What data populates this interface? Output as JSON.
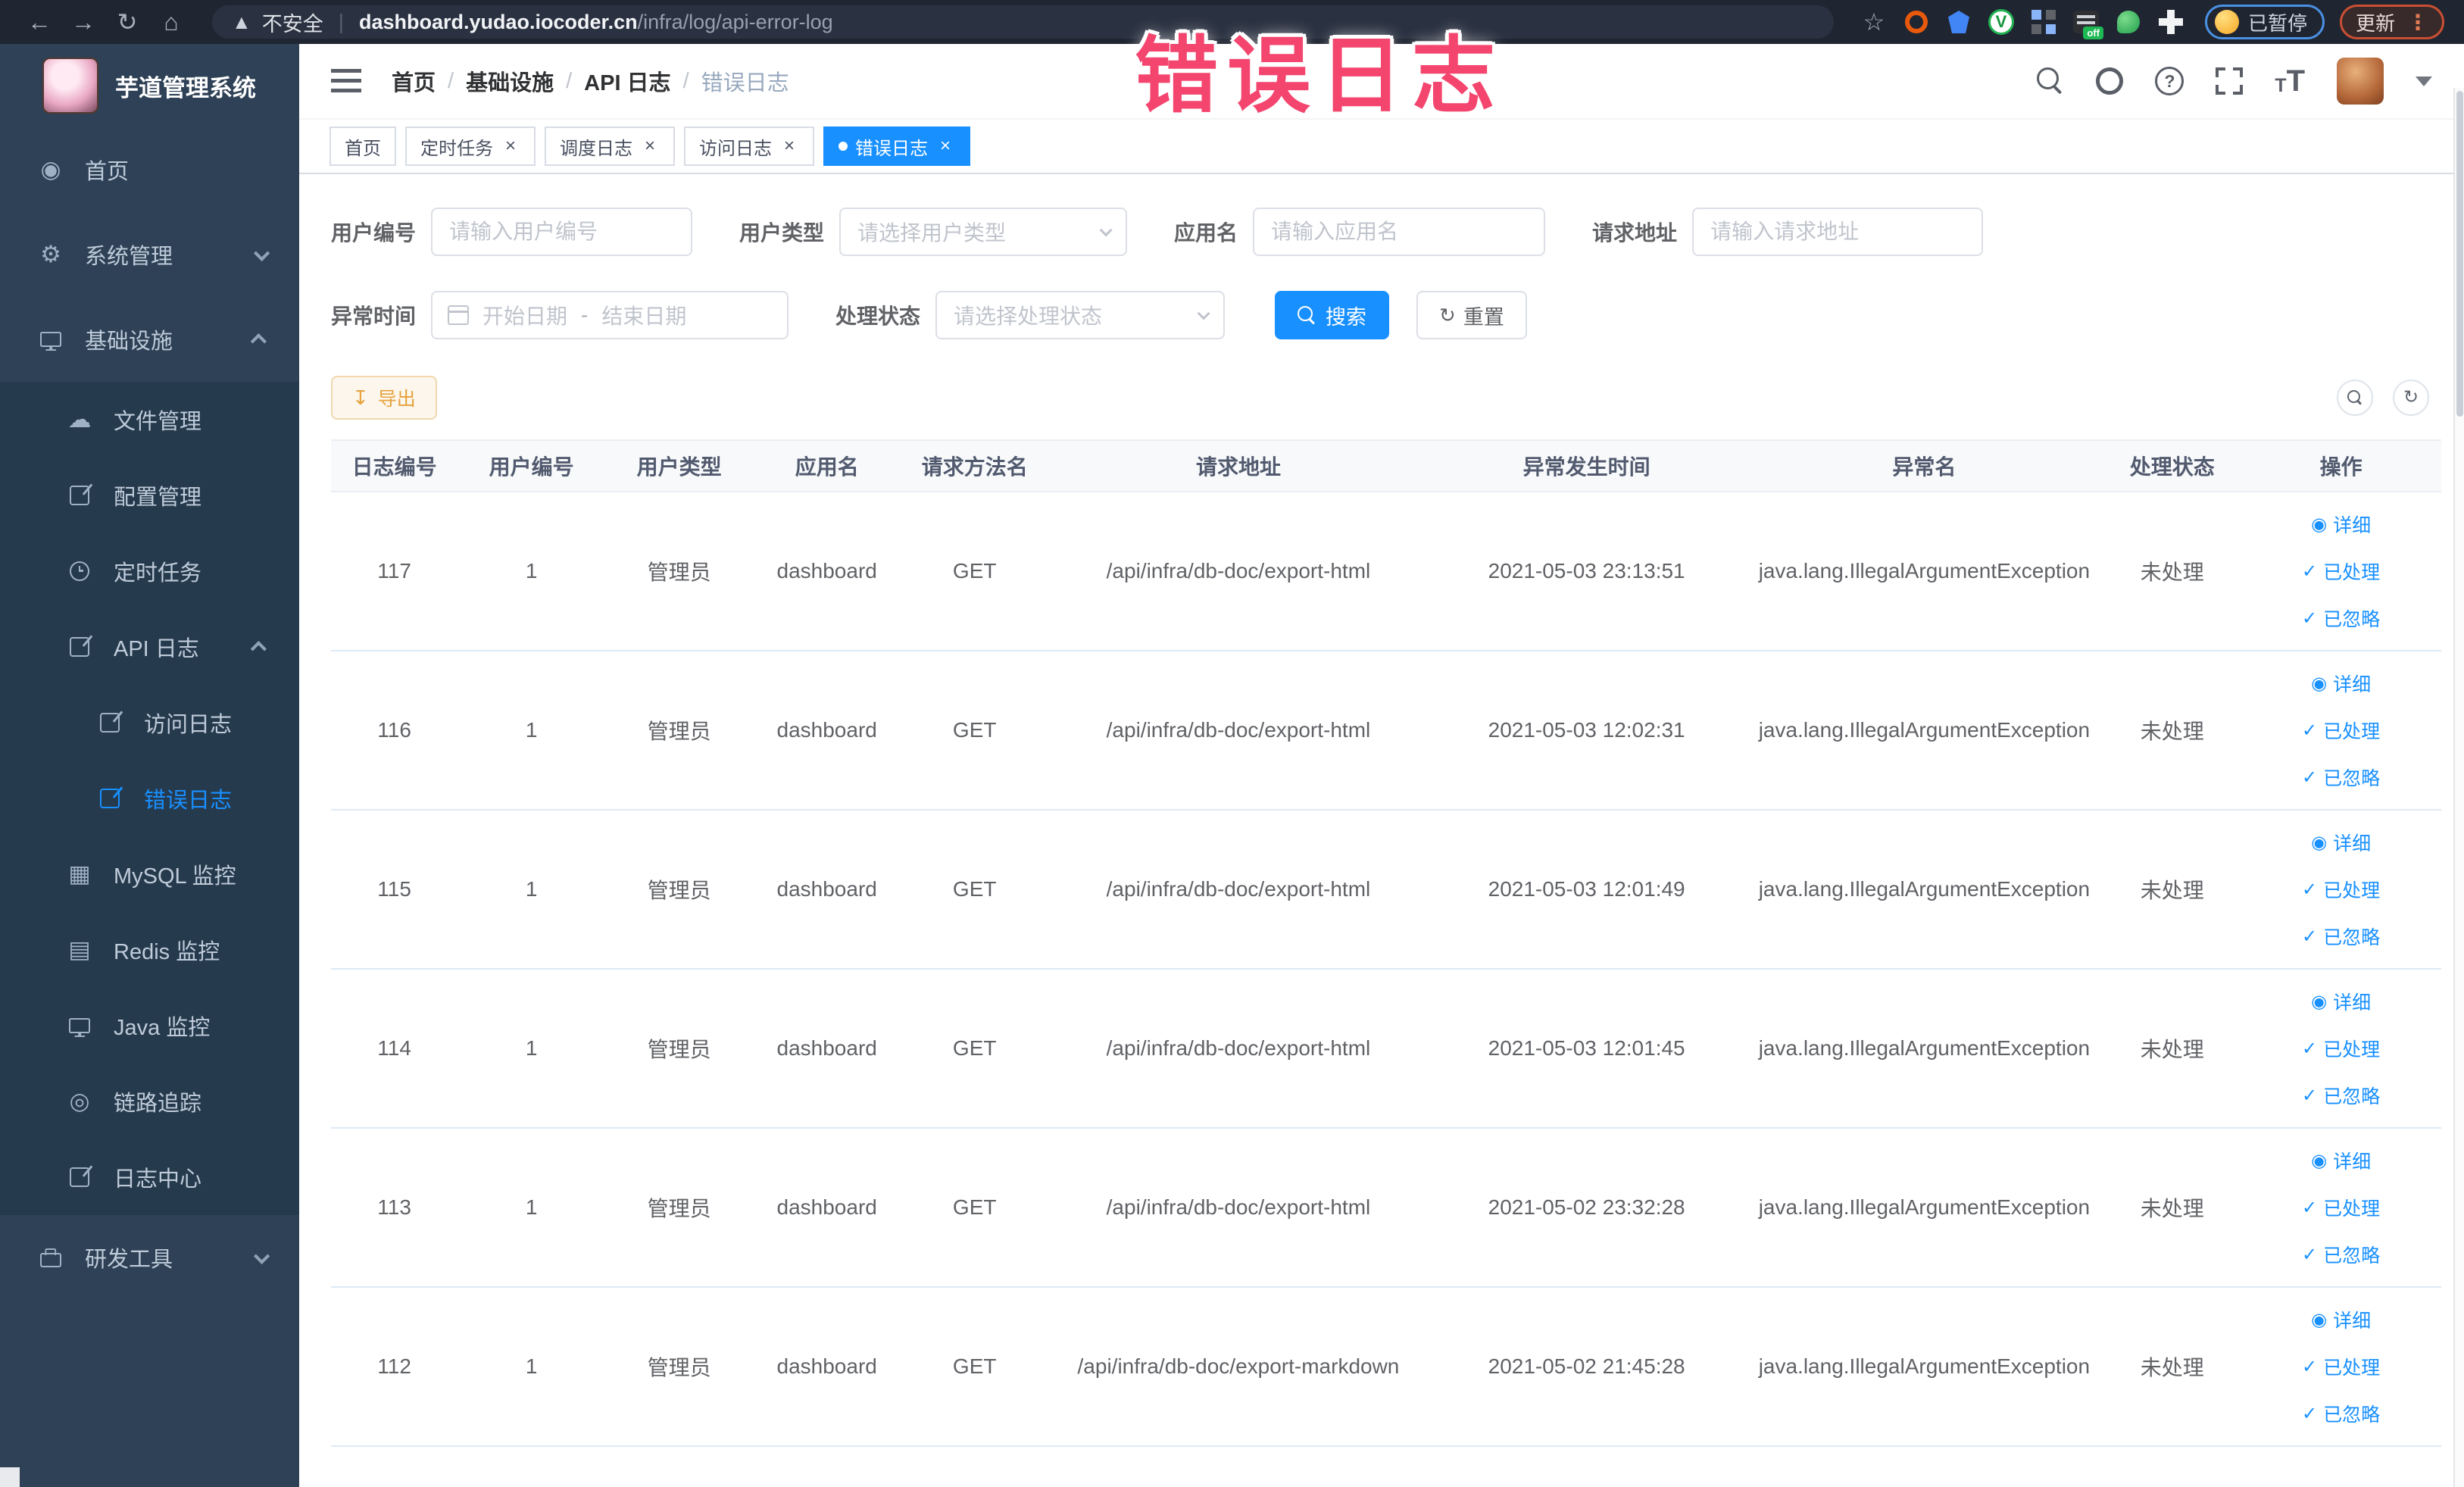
{
  "colors": {
    "accent": "#1890ff",
    "overlay_pink": "#f4456e",
    "sidebar_bg": "#2e4156",
    "sidebar_submenu_bg": "#263a4e",
    "export_orange": "#e6a23c",
    "active_tab_bg": "#1890ff"
  },
  "overlay": {
    "title": "错误日志"
  },
  "browser": {
    "security_label": "不安全",
    "url_host": "dashboard.yudao.iocoder.cn",
    "url_path": "/infra/log/api-error-log",
    "paused_badge": "已暂停",
    "update_button": "更新"
  },
  "sidebar": {
    "app_title": "芋道管理系统",
    "menu": [
      {
        "name": "home",
        "label": "首页",
        "icon": "dashboard-icon",
        "level": 1
      },
      {
        "name": "system-management",
        "label": "系统管理",
        "icon": "gear-icon",
        "level": 1,
        "chevron": "down"
      },
      {
        "name": "infrastructure",
        "label": "基础设施",
        "icon": "monitor-icon",
        "level": 1,
        "chevron": "up"
      },
      {
        "name": "file-management",
        "label": "文件管理",
        "icon": "cloud-upload-icon",
        "level": 2
      },
      {
        "name": "config-management",
        "label": "配置管理",
        "icon": "edit-icon",
        "level": 2
      },
      {
        "name": "scheduled-jobs",
        "label": "定时任务",
        "icon": "clock-icon",
        "level": 2
      },
      {
        "name": "api-log",
        "label": "API 日志",
        "icon": "edit-icon",
        "level": 2,
        "chevron": "up"
      },
      {
        "name": "access-log",
        "label": "访问日志",
        "icon": "edit-icon",
        "level": 3
      },
      {
        "name": "error-log",
        "label": "错误日志",
        "icon": "edit-icon",
        "level": 3,
        "active": true
      },
      {
        "name": "mysql-monitor",
        "label": "MySQL 监控",
        "icon": "mysql-monitor-icon",
        "level": 2
      },
      {
        "name": "redis-monitor",
        "label": "Redis 监控",
        "icon": "redis-monitor-icon",
        "level": 2
      },
      {
        "name": "java-monitor",
        "label": "Java 监控",
        "icon": "java-monitor-icon",
        "level": 2
      },
      {
        "name": "trace",
        "label": "链路追踪",
        "icon": "trace-icon",
        "level": 2
      },
      {
        "name": "log-center",
        "label": "日志中心",
        "icon": "edit-icon",
        "level": 2
      },
      {
        "name": "dev-tools",
        "label": "研发工具",
        "icon": "briefcase-icon",
        "level": 1,
        "chevron": "down"
      }
    ]
  },
  "header": {
    "breadcrumb": [
      "首页",
      "基础设施",
      "API 日志",
      "错误日志"
    ]
  },
  "tabs": [
    {
      "name": "home",
      "label": "首页",
      "closable": false,
      "active": false
    },
    {
      "name": "scheduled-jobs",
      "label": "定时任务",
      "closable": true,
      "active": false
    },
    {
      "name": "job-log",
      "label": "调度日志",
      "closable": true,
      "active": false
    },
    {
      "name": "access-log",
      "label": "访问日志",
      "closable": true,
      "active": false
    },
    {
      "name": "error-log",
      "label": "错误日志",
      "closable": true,
      "active": true
    }
  ],
  "filters": {
    "user_id_label": "用户编号",
    "user_id_placeholder": "请输入用户编号",
    "user_type_label": "用户类型",
    "user_type_placeholder": "请选择用户类型",
    "app_name_label": "应用名",
    "app_name_placeholder": "请输入应用名",
    "request_url_label": "请求地址",
    "request_url_placeholder": "请输入请求地址",
    "exception_time_label": "异常时间",
    "date_start_placeholder": "开始日期",
    "date_separator": "-",
    "date_end_placeholder": "结束日期",
    "process_status_label": "处理状态",
    "process_status_placeholder": "请选择处理状态",
    "search_button": "搜索",
    "reset_button": "重置"
  },
  "toolbar": {
    "export_button": "导出"
  },
  "table": {
    "columns": [
      "日志编号",
      "用户编号",
      "用户类型",
      "应用名",
      "请求方法名",
      "请求地址",
      "异常发生时间",
      "异常名",
      "处理状态",
      "操作"
    ],
    "action_labels": [
      "详细",
      "已处理",
      "已忽略"
    ],
    "rows": [
      {
        "id": "117",
        "user_id": "1",
        "user_type": "管理员",
        "app": "dashboard",
        "method": "GET",
        "url": "/api/infra/db-doc/export-html",
        "time": "2021-05-03 23:13:51",
        "exception": "java.lang.IllegalArgumentException",
        "status": "未处理"
      },
      {
        "id": "116",
        "user_id": "1",
        "user_type": "管理员",
        "app": "dashboard",
        "method": "GET",
        "url": "/api/infra/db-doc/export-html",
        "time": "2021-05-03 12:02:31",
        "exception": "java.lang.IllegalArgumentException",
        "status": "未处理"
      },
      {
        "id": "115",
        "user_id": "1",
        "user_type": "管理员",
        "app": "dashboard",
        "method": "GET",
        "url": "/api/infra/db-doc/export-html",
        "time": "2021-05-03 12:01:49",
        "exception": "java.lang.IllegalArgumentException",
        "status": "未处理"
      },
      {
        "id": "114",
        "user_id": "1",
        "user_type": "管理员",
        "app": "dashboard",
        "method": "GET",
        "url": "/api/infra/db-doc/export-html",
        "time": "2021-05-03 12:01:45",
        "exception": "java.lang.IllegalArgumentException",
        "status": "未处理"
      },
      {
        "id": "113",
        "user_id": "1",
        "user_type": "管理员",
        "app": "dashboard",
        "method": "GET",
        "url": "/api/infra/db-doc/export-html",
        "time": "2021-05-02 23:32:28",
        "exception": "java.lang.IllegalArgumentException",
        "status": "未处理"
      },
      {
        "id": "112",
        "user_id": "1",
        "user_type": "管理员",
        "app": "dashboard",
        "method": "GET",
        "url": "/api/infra/db-doc/export-markdown",
        "time": "2021-05-02 21:45:28",
        "exception": "java.lang.IllegalArgumentException",
        "status": "未处理"
      }
    ]
  }
}
